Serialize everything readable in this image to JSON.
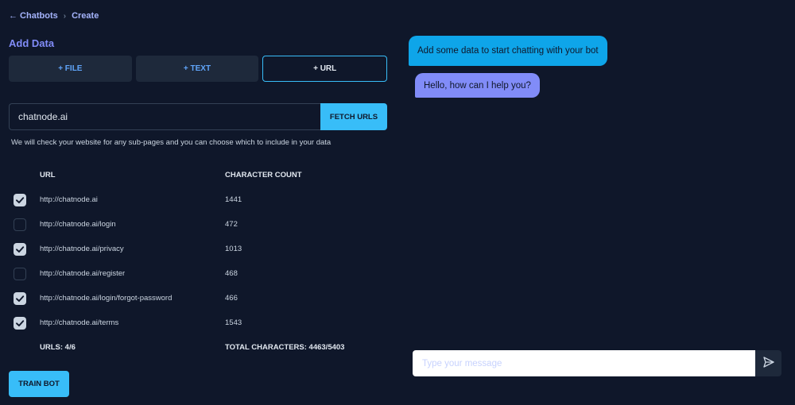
{
  "breadcrumb": {
    "back_label": "← Chatbots",
    "current": "Create",
    "separator": "›"
  },
  "section_title": "Add Data",
  "tabs": [
    {
      "label": "+ FILE",
      "active": false
    },
    {
      "label": "+ TEXT",
      "active": false
    },
    {
      "label": "+ URL",
      "active": true
    }
  ],
  "url_input": {
    "value": "chatnode.ai",
    "placeholder": ""
  },
  "fetch_button": "FETCH URLS",
  "helper_text": "We will check your website for any sub-pages and you can choose which to include in your data",
  "table": {
    "headers": {
      "url": "URL",
      "count": "CHARACTER COUNT"
    },
    "rows": [
      {
        "url": "http://chatnode.ai",
        "count": "1441",
        "checked": true
      },
      {
        "url": "http://chatnode.ai/login",
        "count": "472",
        "checked": false
      },
      {
        "url": "http://chatnode.ai/privacy",
        "count": "1013",
        "checked": true
      },
      {
        "url": "http://chatnode.ai/register",
        "count": "468",
        "checked": false
      },
      {
        "url": "http://chatnode.ai/login/forgot-password",
        "count": "466",
        "checked": true
      },
      {
        "url": "http://chatnode.ai/terms",
        "count": "1543",
        "checked": true
      }
    ],
    "footer": {
      "urls": "URLS: 4/6",
      "total": "TOTAL CHARACTERS: 4463/5403"
    }
  },
  "train_button": "TRAIN BOT",
  "chat": {
    "messages": [
      {
        "text": "Add some data to start chatting with your bot"
      },
      {
        "text": "Hello, how can I help you?"
      }
    ],
    "input_placeholder": "Type your message",
    "send_icon": "send-icon"
  },
  "colors": {
    "background": "#0f172a",
    "accent": "#38bdf8",
    "accent_indigo": "#818cf8",
    "surface": "#1e293b"
  }
}
